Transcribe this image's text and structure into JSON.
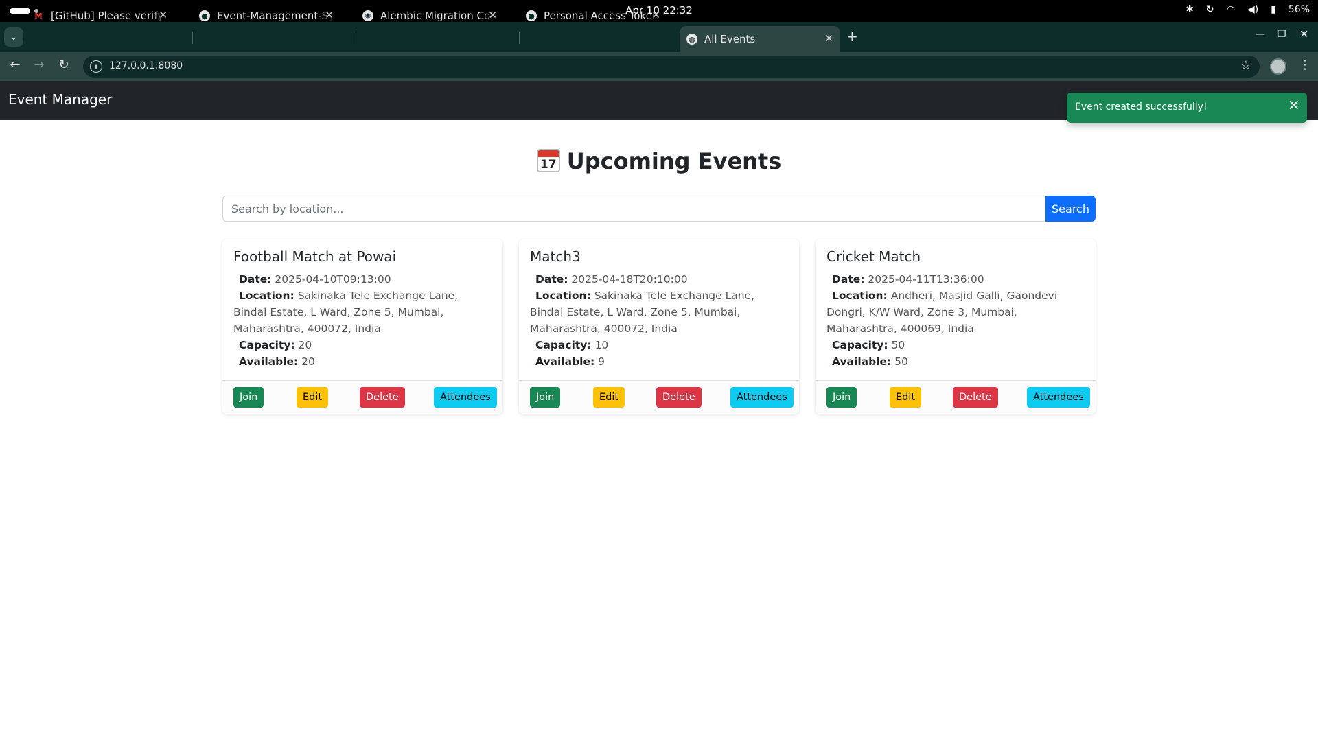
{
  "os": {
    "clock": "Apr 10  22:32",
    "battery": "56%"
  },
  "browser": {
    "tabs": [
      {
        "title": "[GitHub] Please verify your",
        "icon": "gmail-icon",
        "icon_glyph": "M"
      },
      {
        "title": "Event-Management-System",
        "icon": "github-icon",
        "icon_glyph": "●"
      },
      {
        "title": "Alembic Migration Commands",
        "icon": "chatgpt-icon",
        "icon_glyph": "✺"
      },
      {
        "title": "Personal Access Tokens (Classic)",
        "icon": "github-icon",
        "icon_glyph": "●"
      },
      {
        "title": "All Events",
        "icon": "globe-icon",
        "icon_glyph": "◍",
        "active": true
      }
    ],
    "url": "127.0.0.1:8080"
  },
  "navbar": {
    "brand": "Event Manager"
  },
  "toast": {
    "message": "Event created successfully!",
    "color": "#198754"
  },
  "page": {
    "heading": "Upcoming Events",
    "calendar_icon_day": "17",
    "search_placeholder": "Search by location...",
    "search_button": "Search"
  },
  "labels": {
    "date": "Date:",
    "location": "Location:",
    "capacity": "Capacity:",
    "available": "Available:"
  },
  "buttons": {
    "join": "Join",
    "edit": "Edit",
    "delete": "Delete",
    "attendees": "Attendees"
  },
  "events": [
    {
      "title": "Football Match at Powai",
      "date": "2025-04-10T09:13:00",
      "location": "Sakinaka Tele Exchange Lane, Bindal Estate, L Ward, Zone 5, Mumbai, Maharashtra, 400072, India",
      "capacity": "20",
      "available": "20"
    },
    {
      "title": "Match3",
      "date": "2025-04-18T20:10:00",
      "location": "Sakinaka Tele Exchange Lane, Bindal Estate, L Ward, Zone 5, Mumbai, Maharashtra, 400072, India",
      "capacity": "10",
      "available": "9"
    },
    {
      "title": "Cricket Match",
      "date": "2025-04-11T13:36:00",
      "location": "Andheri, Masjid Galli, Gaondevi Dongri, K/W Ward, Zone 3, Mumbai, Maharashtra, 400069, India",
      "capacity": "50",
      "available": "50"
    }
  ],
  "colors": {
    "navbar": "#212529",
    "primary": "#0d6efd",
    "success": "#198754",
    "warning": "#ffc107",
    "danger": "#dc3545",
    "info": "#0dcaf0"
  }
}
